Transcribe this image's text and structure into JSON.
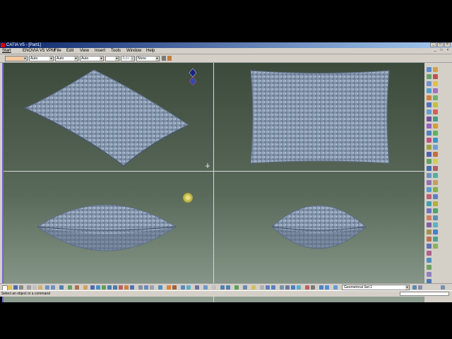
{
  "window": {
    "title": "CATIA V5 - [Part1]",
    "controls": [
      "_",
      "□",
      "×"
    ]
  },
  "menubar": {
    "items": [
      "Start",
      "ENOVIA V5 VPM",
      "File",
      "Edit",
      "View",
      "Insert",
      "Tools",
      "Window",
      "Help"
    ],
    "mdi_controls": [
      "_",
      "□",
      "×"
    ]
  },
  "toolbar": {
    "color_combo": "",
    "linetype_combo": "Auto",
    "thickness_combo": "Auto",
    "point_combo": "Auto",
    "layer_combo": "",
    "transparency_combo": "Auto",
    "renderstyle_combo": "None"
  },
  "workbench": {
    "current_set": "Geometrical Set.1"
  },
  "status": {
    "message": "Select an object or a command"
  },
  "colors": {
    "viewport_top": "#3c4a3c",
    "viewport_bottom": "#8e9e90",
    "pillow_fill": "#7e8fa6",
    "pillow_dark": "#5c6d85"
  }
}
